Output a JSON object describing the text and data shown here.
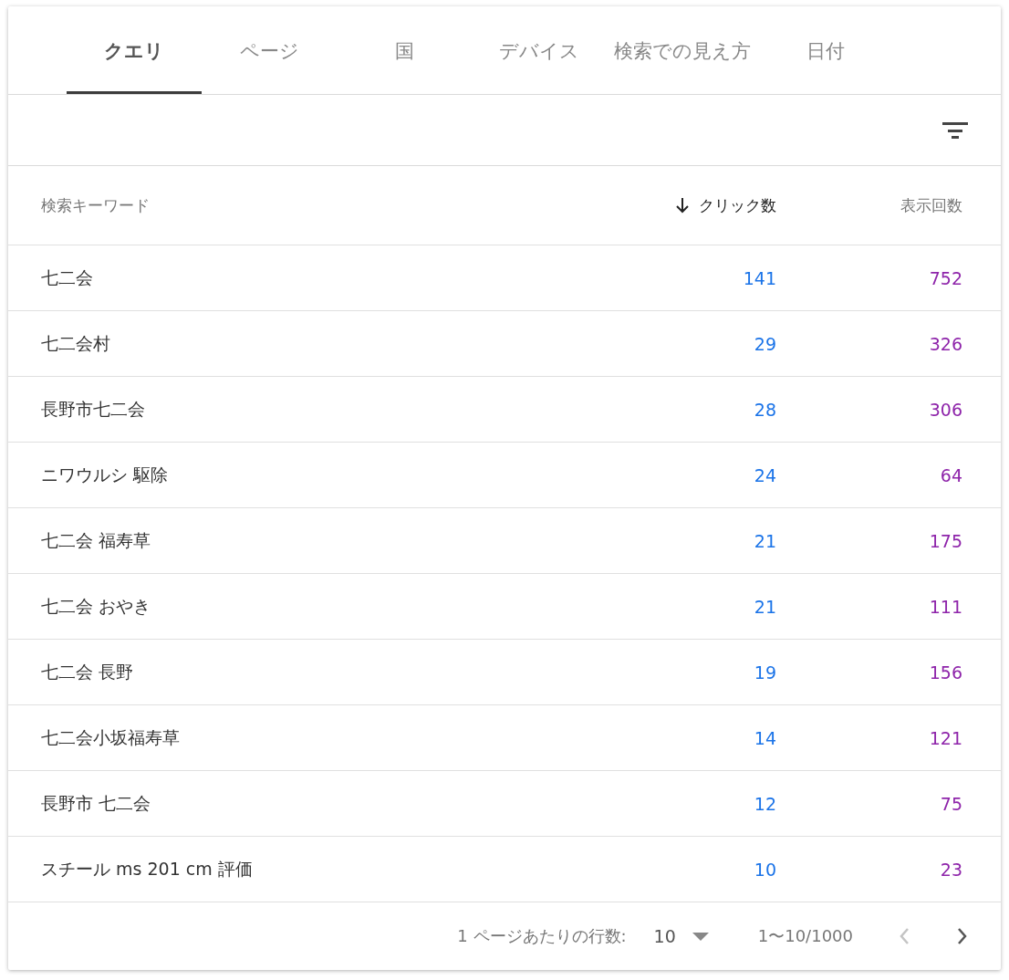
{
  "tabs": [
    {
      "label": "クエリ",
      "selected": true
    },
    {
      "label": "ページ",
      "selected": false
    },
    {
      "label": "国",
      "selected": false
    },
    {
      "label": "デバイス",
      "selected": false
    },
    {
      "label": "検索での見え方",
      "selected": false
    },
    {
      "label": "日付",
      "selected": false
    }
  ],
  "table": {
    "columns": [
      {
        "label": "検索キーワード",
        "sorted": false,
        "kind": "text"
      },
      {
        "label": "クリック数",
        "sorted": true,
        "kind": "number",
        "color": "#1a73e8"
      },
      {
        "label": "表示回数",
        "sorted": false,
        "kind": "number",
        "color": "#8e24aa"
      }
    ],
    "rows": [
      [
        "七二会",
        "141",
        "752"
      ],
      [
        "七二会村",
        "29",
        "326"
      ],
      [
        "長野市七二会",
        "28",
        "306"
      ],
      [
        "ニワウルシ 駆除",
        "24",
        "64"
      ],
      [
        "七二会 福寿草",
        "21",
        "175"
      ],
      [
        "七二会 おやき",
        "21",
        "111"
      ],
      [
        "七二会 長野",
        "19",
        "156"
      ],
      [
        "七二会小坂福寿草",
        "14",
        "121"
      ],
      [
        "長野市 七二会",
        "12",
        "75"
      ],
      [
        "スチール ms 201 cm 評価",
        "10",
        "23"
      ]
    ]
  },
  "pagination": {
    "rows_per_page_label": "1 ページあたりの行数:",
    "rows_per_page": "10",
    "range": "1〜10/1000",
    "previous": {
      "disabled": true
    },
    "next": {
      "disabled": false
    }
  }
}
